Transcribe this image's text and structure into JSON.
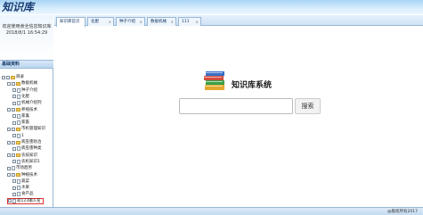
{
  "header": {
    "logo": "知识库"
  },
  "sidebar": {
    "welcome_line1": "欢迎使用食全信息知识库",
    "welcome_line2": "2018/8/1 16:54:29",
    "panel_title": "基础资料",
    "tree": [
      {
        "label": "目录",
        "kind": "folder",
        "exp": "-",
        "level": 0
      },
      {
        "label": "数据机械",
        "kind": "folder",
        "exp": "-",
        "level": 1
      },
      {
        "label": "种子介绍",
        "kind": "file",
        "exp": "",
        "level": 2
      },
      {
        "label": "化肥",
        "kind": "file",
        "exp": "",
        "level": 2
      },
      {
        "label": "机械介绍列",
        "kind": "file",
        "exp": "",
        "level": 2
      },
      {
        "label": "养殖技术",
        "kind": "folder",
        "exp": "-",
        "level": 1
      },
      {
        "label": "家禽",
        "kind": "file",
        "exp": "",
        "level": 2
      },
      {
        "label": "家畜",
        "kind": "file",
        "exp": "",
        "level": 2
      },
      {
        "label": "市机管理知识",
        "kind": "folder",
        "exp": "-",
        "level": 1
      },
      {
        "label": "1",
        "kind": "file",
        "exp": "",
        "level": 2
      },
      {
        "label": "病虫害防治",
        "kind": "folder",
        "exp": "-",
        "level": 1
      },
      {
        "label": "病虫害种类",
        "kind": "file",
        "exp": "",
        "level": 2
      },
      {
        "label": "农技知识",
        "kind": "folder",
        "exp": "-",
        "level": 1
      },
      {
        "label": "农机知识1",
        "kind": "file",
        "exp": "",
        "level": 2
      },
      {
        "label": "市场趋势",
        "kind": "file",
        "exp": "",
        "level": 1
      },
      {
        "label": "种植技术",
        "kind": "folder",
        "exp": "-",
        "level": 1
      },
      {
        "label": "蔬菜",
        "kind": "file",
        "exp": "",
        "level": 2
      },
      {
        "label": "水果",
        "kind": "file",
        "exp": "",
        "level": 2
      },
      {
        "label": "食产品",
        "kind": "file",
        "exp": "",
        "level": 2
      },
      {
        "label": "就123输入名",
        "kind": "file",
        "exp": "",
        "level": 1,
        "highlight": true
      }
    ]
  },
  "tabs": [
    {
      "label": "知识库首页",
      "closable": false,
      "active": true
    },
    {
      "label": "化肥",
      "closable": true,
      "active": false
    },
    {
      "label": "种子介绍",
      "closable": true,
      "active": false
    },
    {
      "label": "数据机械",
      "closable": true,
      "active": false
    },
    {
      "label": "111",
      "closable": true,
      "active": false
    }
  ],
  "main": {
    "title": "知识库系统",
    "search_placeholder": "",
    "search_button": "搜索"
  },
  "footer": {
    "copyright": "@版权所有2017"
  },
  "colors": {
    "header_top": "#a8d4f5",
    "border": "#99b7d8",
    "logo": "#1a3c74",
    "highlight": "#e03030"
  }
}
